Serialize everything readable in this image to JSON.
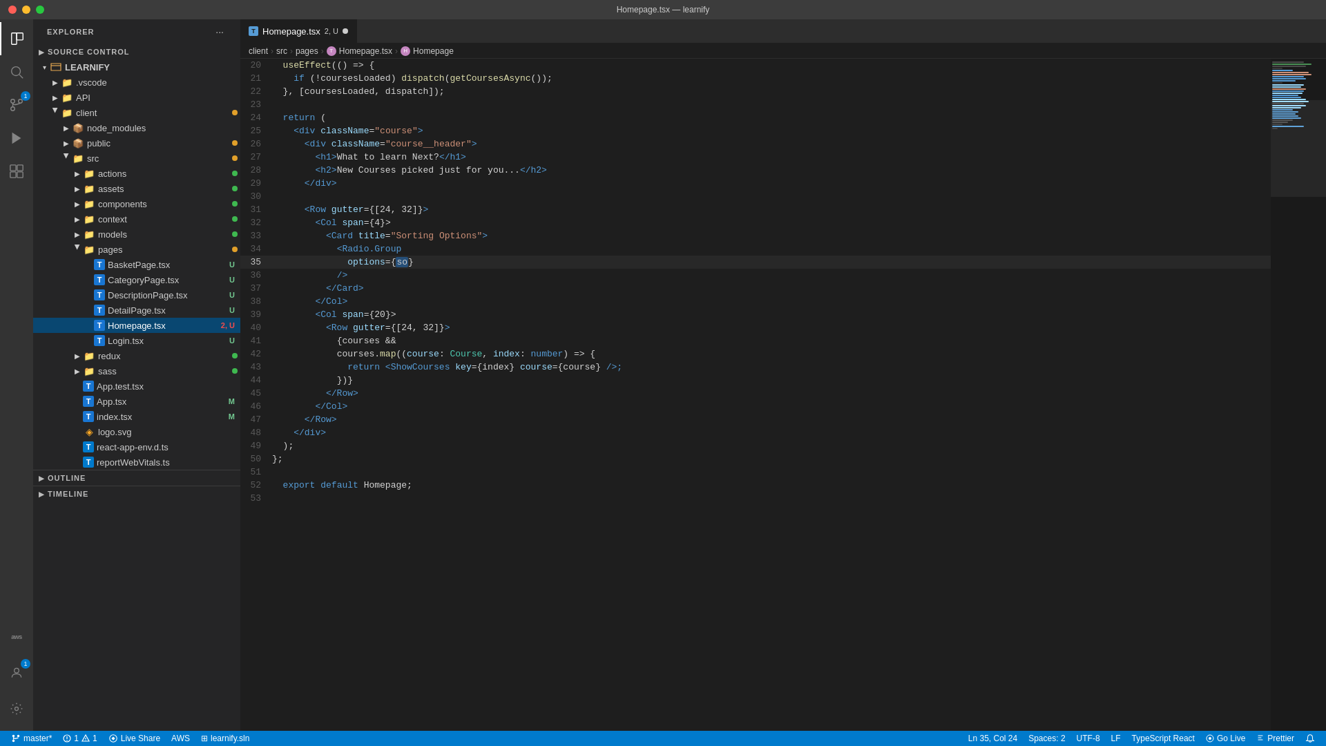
{
  "titleBar": {
    "title": "Homepage.tsx — learnify",
    "buttons": {
      "close": "●",
      "min": "●",
      "max": "●"
    }
  },
  "activityBar": {
    "items": [
      {
        "name": "explorer",
        "icon": "❐",
        "active": true,
        "badge": null
      },
      {
        "name": "search",
        "icon": "⌕",
        "active": false,
        "badge": null
      },
      {
        "name": "source-control",
        "icon": "⑂",
        "active": false,
        "badge": "1"
      },
      {
        "name": "run-debug",
        "icon": "▷",
        "active": false,
        "badge": null
      },
      {
        "name": "extensions",
        "icon": "⊞",
        "active": false,
        "badge": null
      },
      {
        "name": "remote",
        "icon": "≺",
        "active": false,
        "badge": null
      }
    ],
    "bottom": [
      {
        "name": "aws",
        "icon": "aws",
        "label": "aws"
      },
      {
        "name": "account",
        "icon": "👤"
      },
      {
        "name": "settings",
        "icon": "⚙"
      }
    ]
  },
  "sidebar": {
    "header": "EXPLORER",
    "sourceControl": {
      "label": "SOURCE CONTROL",
      "badge": "1"
    },
    "tree": {
      "root": "LEARNIFY",
      "items": [
        {
          "id": "vscode",
          "label": ".vscode",
          "type": "folder",
          "indent": 1,
          "open": false,
          "badge": null
        },
        {
          "id": "API",
          "label": "API",
          "type": "folder",
          "indent": 1,
          "open": false,
          "badge": null
        },
        {
          "id": "client",
          "label": "client",
          "type": "folder",
          "indent": 1,
          "open": true,
          "badge": "dot-orange"
        },
        {
          "id": "node_modules",
          "label": "node_modules",
          "type": "folder-pkg",
          "indent": 2,
          "open": false,
          "badge": null
        },
        {
          "id": "public",
          "label": "public",
          "type": "folder-pkg",
          "indent": 2,
          "open": false,
          "badge": "dot-orange"
        },
        {
          "id": "src",
          "label": "src",
          "type": "folder-src",
          "indent": 2,
          "open": true,
          "badge": "dot-orange"
        },
        {
          "id": "actions",
          "label": "actions",
          "type": "folder",
          "indent": 3,
          "open": false,
          "badge": "dot-green"
        },
        {
          "id": "assets",
          "label": "assets",
          "type": "folder",
          "indent": 3,
          "open": false,
          "badge": "dot-green"
        },
        {
          "id": "components",
          "label": "components",
          "type": "folder",
          "indent": 3,
          "open": false,
          "badge": "dot-green"
        },
        {
          "id": "context",
          "label": "context",
          "type": "folder",
          "indent": 3,
          "open": false,
          "badge": "dot-green"
        },
        {
          "id": "models",
          "label": "models",
          "type": "folder",
          "indent": 3,
          "open": false,
          "badge": "dot-green"
        },
        {
          "id": "pages",
          "label": "pages",
          "type": "folder-pages",
          "indent": 3,
          "open": true,
          "badge": "dot-orange"
        },
        {
          "id": "BasketPage",
          "label": "BasketPage.tsx",
          "type": "file-tsx",
          "indent": 4,
          "badge": "U"
        },
        {
          "id": "CategoryPage",
          "label": "CategoryPage.tsx",
          "type": "file-tsx",
          "indent": 4,
          "badge": "U"
        },
        {
          "id": "DescriptionPage",
          "label": "DescriptionPage.tsx",
          "type": "file-tsx",
          "indent": 4,
          "badge": "U"
        },
        {
          "id": "DetailPage",
          "label": "DetailPage.tsx",
          "type": "file-tsx",
          "indent": 4,
          "badge": "U"
        },
        {
          "id": "Homepage",
          "label": "Homepage.tsx",
          "type": "file-tsx",
          "indent": 4,
          "badge": "2, U",
          "active": true
        },
        {
          "id": "Login",
          "label": "Login.tsx",
          "type": "file-tsx",
          "indent": 4,
          "badge": "U"
        },
        {
          "id": "redux",
          "label": "redux",
          "type": "folder",
          "indent": 3,
          "open": false,
          "badge": "dot-green"
        },
        {
          "id": "sass",
          "label": "sass",
          "type": "folder-src",
          "indent": 3,
          "open": false,
          "badge": "dot-green"
        },
        {
          "id": "AppTest",
          "label": "App.test.tsx",
          "type": "file-tsx",
          "indent": 3,
          "badge": null
        },
        {
          "id": "AppTsx",
          "label": "App.tsx",
          "type": "file-tsx",
          "indent": 3,
          "badge": "M"
        },
        {
          "id": "indexTsx",
          "label": "index.tsx",
          "type": "file-tsx",
          "indent": 3,
          "badge": "M"
        },
        {
          "id": "logoSvg",
          "label": "logo.svg",
          "type": "file-svg",
          "indent": 3,
          "badge": null
        },
        {
          "id": "reactApp",
          "label": "react-app-env.d.ts",
          "type": "file-ts",
          "indent": 3,
          "badge": null
        },
        {
          "id": "reportWeb",
          "label": "reportWebVitals.ts",
          "type": "file-ts",
          "indent": 3,
          "badge": null
        }
      ]
    },
    "outline": "OUTLINE",
    "timeline": "TIMELINE"
  },
  "tabs": [
    {
      "label": "Homepage.tsx",
      "status": "2, U",
      "active": true,
      "unsaved": true
    }
  ],
  "breadcrumb": [
    {
      "label": "client"
    },
    {
      "label": "src"
    },
    {
      "label": "pages"
    },
    {
      "label": "Homepage.tsx",
      "hasIcon": true
    },
    {
      "label": "Homepage",
      "hasIcon": true
    }
  ],
  "editor": {
    "lines": [
      {
        "num": 20,
        "content": [
          {
            "text": "  useEffect(() => {",
            "color": "dflt"
          }
        ]
      },
      {
        "num": 21,
        "content": [
          {
            "text": "    ",
            "color": "dflt"
          },
          {
            "text": "if",
            "color": "k"
          },
          {
            "text": " (!coursesLoaded) dispatch(",
            "color": "dflt"
          },
          {
            "text": "getCoursesAsync",
            "color": "fn"
          },
          {
            "text": "());",
            "color": "dflt"
          }
        ]
      },
      {
        "num": 22,
        "content": [
          {
            "text": "  }, [coursesLoaded, dispatch]);",
            "color": "dflt"
          }
        ]
      },
      {
        "num": 23,
        "content": [
          {
            "text": "",
            "color": "dflt"
          }
        ]
      },
      {
        "num": 24,
        "content": [
          {
            "text": "  ",
            "color": "dflt"
          },
          {
            "text": "return",
            "color": "k"
          },
          {
            "text": " (",
            "color": "dflt"
          }
        ]
      },
      {
        "num": 25,
        "content": [
          {
            "text": "    ",
            "color": "dflt"
          },
          {
            "text": "<div",
            "color": "jsx"
          },
          {
            "text": " ",
            "color": "dflt"
          },
          {
            "text": "className",
            "color": "atr"
          },
          {
            "text": "=",
            "color": "op"
          },
          {
            "text": "\"course\"",
            "color": "str"
          },
          {
            "text": ">",
            "color": "jsx"
          }
        ]
      },
      {
        "num": 26,
        "content": [
          {
            "text": "      ",
            "color": "dflt"
          },
          {
            "text": "<div",
            "color": "jsx"
          },
          {
            "text": " ",
            "color": "dflt"
          },
          {
            "text": "className",
            "color": "atr"
          },
          {
            "text": "=",
            "color": "op"
          },
          {
            "text": "\"course__header\"",
            "color": "str"
          },
          {
            "text": ">",
            "color": "jsx"
          }
        ]
      },
      {
        "num": 27,
        "content": [
          {
            "text": "        ",
            "color": "dflt"
          },
          {
            "text": "<h1>",
            "color": "jsx"
          },
          {
            "text": "What to learn Next?",
            "color": "dflt"
          },
          {
            "text": "</h1>",
            "color": "jsx"
          }
        ]
      },
      {
        "num": 28,
        "content": [
          {
            "text": "        ",
            "color": "dflt"
          },
          {
            "text": "<h2>",
            "color": "jsx"
          },
          {
            "text": "New Courses picked just for you...",
            "color": "dflt"
          },
          {
            "text": "</h2>",
            "color": "jsx"
          }
        ]
      },
      {
        "num": 29,
        "content": [
          {
            "text": "      ",
            "color": "dflt"
          },
          {
            "text": "</div>",
            "color": "jsx"
          }
        ]
      },
      {
        "num": 30,
        "content": [
          {
            "text": "",
            "color": "dflt"
          }
        ]
      },
      {
        "num": 31,
        "content": [
          {
            "text": "      ",
            "color": "dflt"
          },
          {
            "text": "<Row",
            "color": "jsx"
          },
          {
            "text": " ",
            "color": "dflt"
          },
          {
            "text": "gutter",
            "color": "atr"
          },
          {
            "text": "={[24, 32]}",
            "color": "dflt"
          },
          {
            "text": ">",
            "color": "jsx"
          }
        ]
      },
      {
        "num": 32,
        "content": [
          {
            "text": "        ",
            "color": "dflt"
          },
          {
            "text": "<Col",
            "color": "jsx"
          },
          {
            "text": " ",
            "color": "dflt"
          },
          {
            "text": "span",
            "color": "atr"
          },
          {
            "text": "={4}>",
            "color": "dflt"
          }
        ]
      },
      {
        "num": 33,
        "content": [
          {
            "text": "          ",
            "color": "dflt"
          },
          {
            "text": "<Card",
            "color": "jsx"
          },
          {
            "text": " ",
            "color": "dflt"
          },
          {
            "text": "title",
            "color": "atr"
          },
          {
            "text": "=",
            "color": "op"
          },
          {
            "text": "\"Sorting Options\"",
            "color": "str"
          },
          {
            "text": ">",
            "color": "jsx"
          }
        ]
      },
      {
        "num": 34,
        "content": [
          {
            "text": "            ",
            "color": "dflt"
          },
          {
            "text": "<Radio.Group",
            "color": "jsx"
          }
        ]
      },
      {
        "num": 35,
        "content": [
          {
            "text": "              options={",
            "color": "dflt"
          },
          {
            "text": "so",
            "color": "selection"
          },
          {
            "text": "}",
            "color": "dflt"
          }
        ],
        "active": true
      },
      {
        "num": 36,
        "content": [
          {
            "text": "            ",
            "color": "dflt"
          },
          {
            "text": "/>",
            "color": "jsx"
          }
        ]
      },
      {
        "num": 37,
        "content": [
          {
            "text": "          ",
            "color": "dflt"
          },
          {
            "text": "</Card>",
            "color": "jsx"
          }
        ]
      },
      {
        "num": 38,
        "content": [
          {
            "text": "        ",
            "color": "dflt"
          },
          {
            "text": "</Col>",
            "color": "jsx"
          }
        ]
      },
      {
        "num": 39,
        "content": [
          {
            "text": "        ",
            "color": "dflt"
          },
          {
            "text": "<Col",
            "color": "jsx"
          },
          {
            "text": " ",
            "color": "dflt"
          },
          {
            "text": "span",
            "color": "atr"
          },
          {
            "text": "={20}>",
            "color": "dflt"
          }
        ]
      },
      {
        "num": 40,
        "content": [
          {
            "text": "          ",
            "color": "dflt"
          },
          {
            "text": "<Row",
            "color": "jsx"
          },
          {
            "text": " ",
            "color": "dflt"
          },
          {
            "text": "gutter",
            "color": "atr"
          },
          {
            "text": "={[24, 32]}",
            "color": "dflt"
          },
          {
            "text": ">",
            "color": "jsx"
          }
        ]
      },
      {
        "num": 41,
        "content": [
          {
            "text": "            ",
            "color": "dflt"
          },
          {
            "text": "{courses &&",
            "color": "dflt"
          }
        ]
      },
      {
        "num": 42,
        "content": [
          {
            "text": "            courses.",
            "color": "dflt"
          },
          {
            "text": "map",
            "color": "fn"
          },
          {
            "text": "((",
            "color": "dflt"
          },
          {
            "text": "course",
            "color": "var"
          },
          {
            "text": ": ",
            "color": "dflt"
          },
          {
            "text": "Course",
            "color": "cls"
          },
          {
            "text": ", ",
            "color": "dflt"
          },
          {
            "text": "index",
            "color": "var"
          },
          {
            "text": ": ",
            "color": "dflt"
          },
          {
            "text": "number",
            "color": "k"
          },
          {
            "text": ") => {",
            "color": "dflt"
          }
        ]
      },
      {
        "num": 43,
        "content": [
          {
            "text": "              ",
            "color": "dflt"
          },
          {
            "text": "return",
            "color": "k"
          },
          {
            "text": " ",
            "color": "dflt"
          },
          {
            "text": "<ShowCourses",
            "color": "jsx"
          },
          {
            "text": " ",
            "color": "dflt"
          },
          {
            "text": "key",
            "color": "atr"
          },
          {
            "text": "={index}",
            "color": "dflt"
          },
          {
            "text": " course",
            "color": "atr"
          },
          {
            "text": "={course}",
            "color": "dflt"
          },
          {
            "text": " />;",
            "color": "jsx"
          }
        ]
      },
      {
        "num": 44,
        "content": [
          {
            "text": "            ",
            "color": "dflt"
          },
          {
            "text": "})}",
            "color": "dflt"
          }
        ]
      },
      {
        "num": 45,
        "content": [
          {
            "text": "          ",
            "color": "dflt"
          },
          {
            "text": "</Row>",
            "color": "jsx"
          }
        ]
      },
      {
        "num": 46,
        "content": [
          {
            "text": "        ",
            "color": "dflt"
          },
          {
            "text": "</Col>",
            "color": "jsx"
          }
        ]
      },
      {
        "num": 47,
        "content": [
          {
            "text": "      ",
            "color": "dflt"
          },
          {
            "text": "</Row>",
            "color": "jsx"
          }
        ]
      },
      {
        "num": 48,
        "content": [
          {
            "text": "    ",
            "color": "dflt"
          },
          {
            "text": "</div>",
            "color": "jsx"
          }
        ]
      },
      {
        "num": 49,
        "content": [
          {
            "text": "  );",
            "color": "dflt"
          }
        ]
      },
      {
        "num": 50,
        "content": [
          {
            "text": "};",
            "color": "dflt"
          }
        ]
      },
      {
        "num": 51,
        "content": [
          {
            "text": "",
            "color": "dflt"
          }
        ]
      },
      {
        "num": 52,
        "content": [
          {
            "text": "  ",
            "color": "dflt"
          },
          {
            "text": "export",
            "color": "k"
          },
          {
            "text": " ",
            "color": "dflt"
          },
          {
            "text": "default",
            "color": "k"
          },
          {
            "text": " Homepage;",
            "color": "dflt"
          }
        ]
      },
      {
        "num": 53,
        "content": [
          {
            "text": "",
            "color": "dflt"
          }
        ]
      }
    ]
  },
  "statusBar": {
    "branch": "master*",
    "errors": "1",
    "warnings": "1",
    "liveShare": "Live Share",
    "aws": "AWS",
    "solution": "learnify.sln",
    "lineCol": "Ln 35, Col 24",
    "spaces": "Spaces: 2",
    "encoding": "UTF-8",
    "lineEnding": "LF",
    "language": "TypeScript React",
    "goCLive": "Go Live",
    "prettier": "Prettier"
  }
}
